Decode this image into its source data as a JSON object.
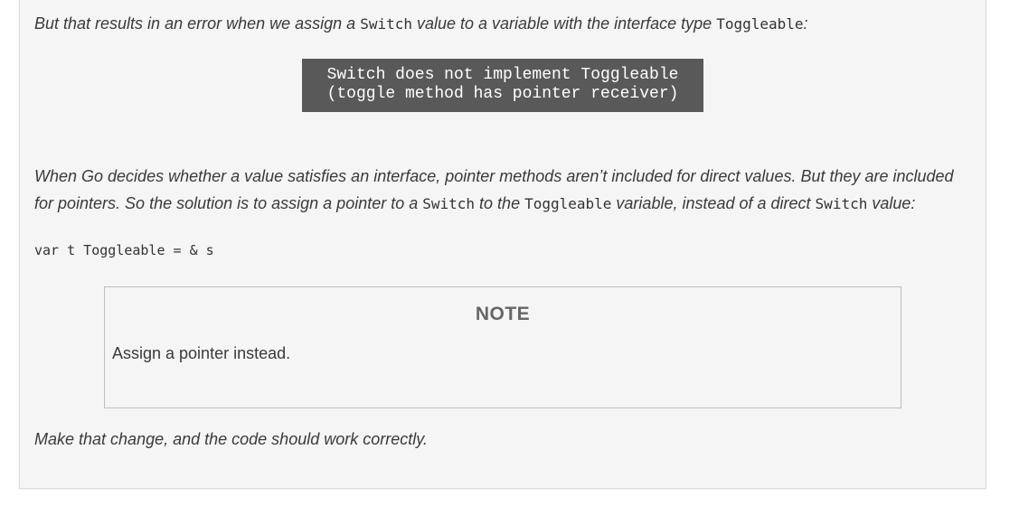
{
  "intro": {
    "t1": "But that results in an error when we assign a ",
    "c1": "Switch",
    "t2": " value to a variable with the interface type ",
    "c2": "Toggleable",
    "t3": ":"
  },
  "error_message": {
    "line1": "Switch does not implement Toggleable",
    "line2": "(toggle method has pointer receiver)"
  },
  "explanation": {
    "line1": "When Go decides whether a value satisfies an interface, pointer methods aren’t included for direct values. But they are included",
    "l2_t1": "for pointers. So the solution is to assign a pointer to a ",
    "l2_c1": "Switch",
    "l2_t2": " to the ",
    "l2_c2": "Toggleable",
    "l2_t3": " variable, instead of a direct ",
    "l2_c3": "Switch",
    "l2_t4": " value:"
  },
  "code": {
    "line": "var t Toggleable = & s"
  },
  "note": {
    "title": "NOTE",
    "body": "Assign a pointer instead."
  },
  "closing": {
    "text": "Make that change, and the code should work correctly."
  }
}
